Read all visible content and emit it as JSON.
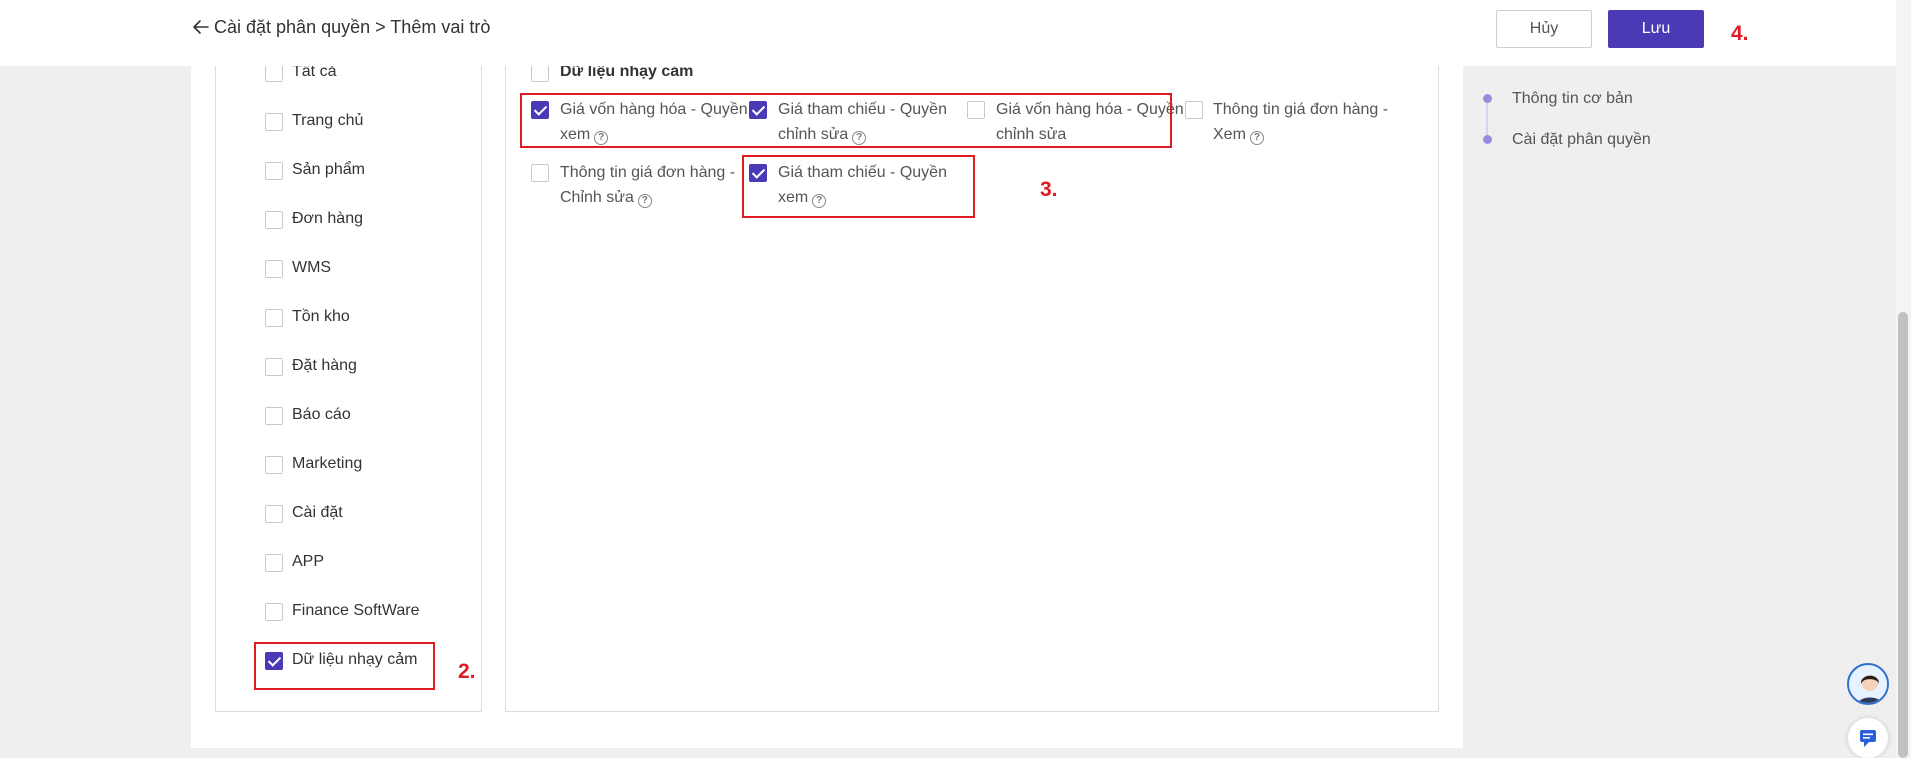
{
  "header": {
    "breadcrumb": "Cài đặt phân quyền > Thêm vai trò",
    "cancel_label": "Hủy",
    "save_label": "Lưu"
  },
  "annotations": {
    "step2": "2.",
    "step3": "3.",
    "step4": "4."
  },
  "modules": [
    {
      "label": "Tất cả",
      "checked": false
    },
    {
      "label": "Trang chủ",
      "checked": false
    },
    {
      "label": "Sản phẩm",
      "checked": false
    },
    {
      "label": "Đơn hàng",
      "checked": false
    },
    {
      "label": "WMS",
      "checked": false
    },
    {
      "label": "Tồn kho",
      "checked": false
    },
    {
      "label": "Đặt hàng",
      "checked": false
    },
    {
      "label": "Báo cáo",
      "checked": false
    },
    {
      "label": "Marketing",
      "checked": false
    },
    {
      "label": "Cài đặt",
      "checked": false
    },
    {
      "label": "APP",
      "checked": false
    },
    {
      "label": "Finance SoftWare",
      "checked": false
    },
    {
      "label": "Dữ liệu nhạy cảm",
      "checked": true
    }
  ],
  "section": {
    "title": "Dữ liệu nhạy cảm",
    "checked": false
  },
  "permissions": [
    {
      "label": "Giá vốn hàng hóa - Quyền xem",
      "checked": true
    },
    {
      "label": "Giá tham chiếu - Quyền chỉnh sửa",
      "checked": true
    },
    {
      "label": "Giá vốn hàng hóa - Quyền chỉnh sửa",
      "checked": false
    },
    {
      "label": "Thông tin giá đơn hàng - Xem",
      "checked": false
    },
    {
      "label": "Thông tin giá đơn hàng - Chỉnh sửa",
      "checked": false
    },
    {
      "label": "Giá tham chiếu - Quyền xem",
      "checked": true
    }
  ],
  "steps": [
    {
      "label": "Thông tin cơ bản"
    },
    {
      "label": "Cài đặt phân quyền"
    }
  ],
  "colors": {
    "primary": "#4a3ab5",
    "annotation": "#e21b23"
  }
}
